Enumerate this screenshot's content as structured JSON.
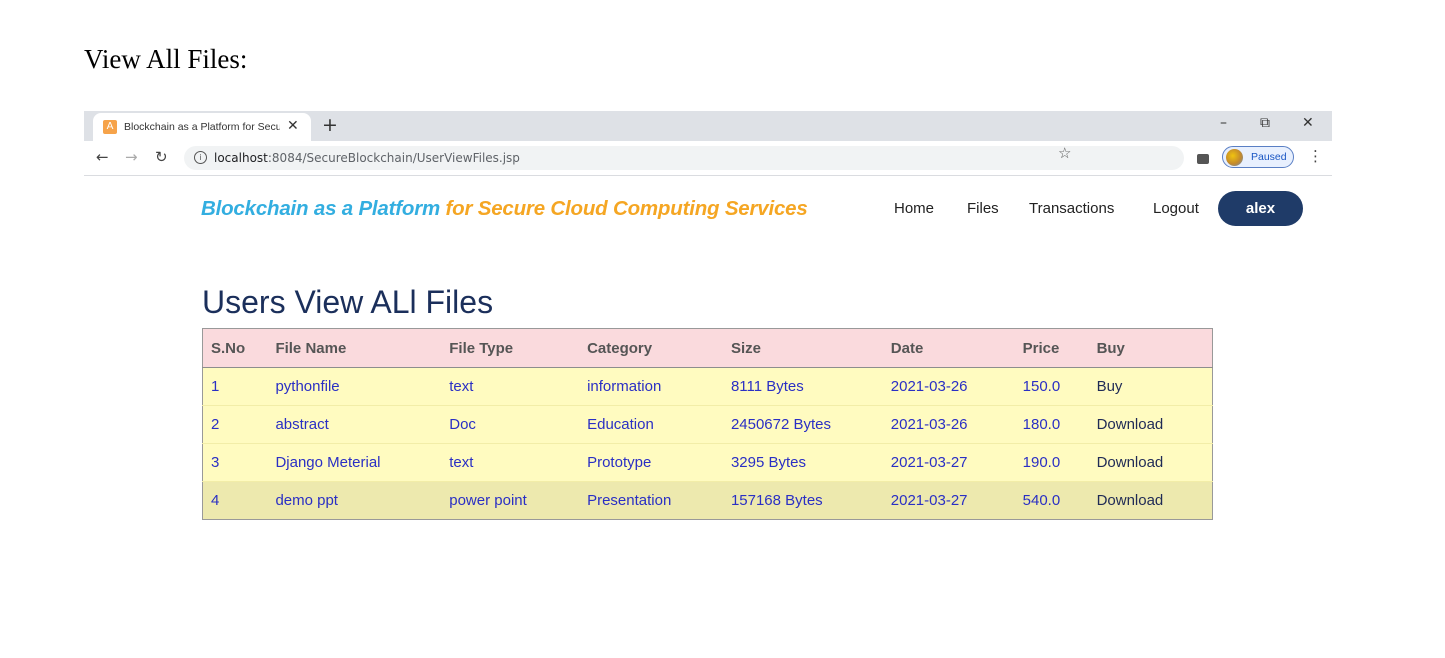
{
  "document": {
    "heading": "View All Files:"
  },
  "browser": {
    "tab": {
      "title": "Blockchain as a Platform for Secu",
      "favicon_letter": "A"
    },
    "new_tab_symbol": "+",
    "window_controls": {
      "minimize": "–",
      "restore": "⧉",
      "close": "✕"
    },
    "toolbar": {
      "url_host": "localhost",
      "url_rest": ":8084/SecureBlockchain/UserViewFiles.jsp",
      "profile_status": "Paused"
    }
  },
  "site": {
    "brand_part1": "Blockchain as a Platform",
    "brand_part2": "for Secure Cloud Computing Services",
    "nav": {
      "home": "Home",
      "files": "Files",
      "transactions": "Transactions",
      "logout": "Logout"
    },
    "user": "alex"
  },
  "main": {
    "title": "Users View ALl Files",
    "table": {
      "headers": [
        "S.No",
        "File Name",
        "File Type",
        "Category",
        "Size",
        "Date",
        "Price",
        "Buy"
      ],
      "rows": [
        [
          "1",
          "pythonfile",
          "text",
          "information",
          "8111 Bytes",
          "2021-03-26",
          "150.0",
          "Buy"
        ],
        [
          "2",
          "abstract",
          "Doc",
          "Education",
          "2450672 Bytes",
          "2021-03-26",
          "180.0",
          "Download"
        ],
        [
          "3",
          "Django Meterial",
          "text",
          "Prototype",
          "3295 Bytes",
          "2021-03-27",
          "190.0",
          "Download"
        ],
        [
          "4",
          "demo ppt",
          "power point",
          "Presentation",
          "157168 Bytes",
          "2021-03-27",
          "540.0",
          "Download"
        ]
      ]
    }
  },
  "icons": {
    "back": "back-arrow-icon",
    "forward": "forward-arrow-icon",
    "reload": "reload-icon",
    "info": "info-icon",
    "star": "bookmark-star-icon",
    "extensions": "puzzle-icon",
    "menu": "kebab-menu-icon"
  },
  "colors": {
    "brand_blue": "#33aee0",
    "brand_orange": "#f5a623",
    "user_button": "#1f3b68",
    "table_header_bg": "#fadadd",
    "table_row_bg": "#fffbc0",
    "table_text": "#2a2fc4"
  }
}
